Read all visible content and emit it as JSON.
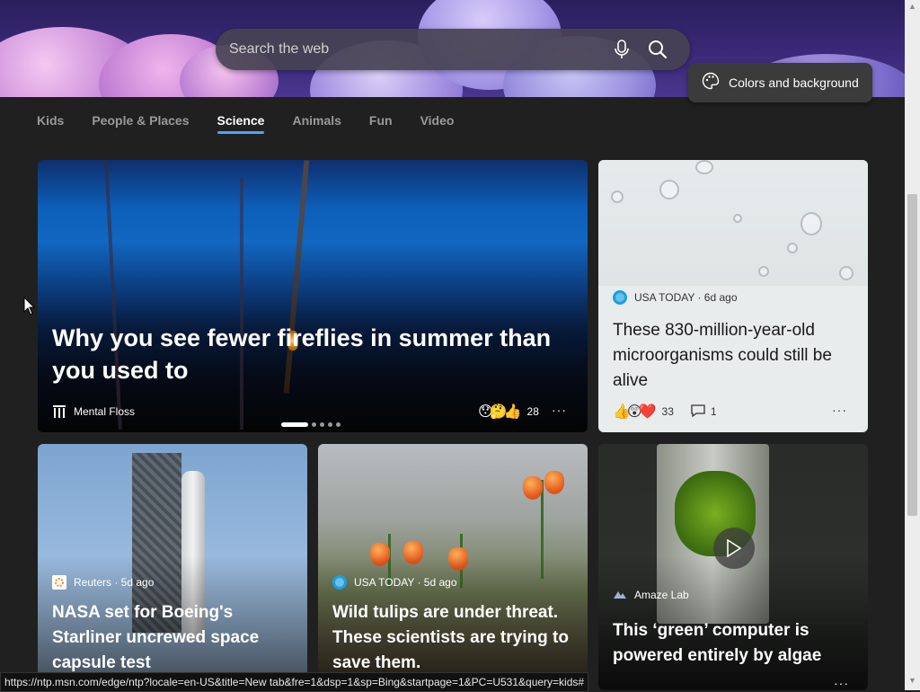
{
  "search": {
    "placeholder": "Search the web"
  },
  "colors_button": {
    "label": "Colors and background"
  },
  "tabs": [
    "Kids",
    "People & Places",
    "Science",
    "Animals",
    "Fun",
    "Video"
  ],
  "active_tab": "Science",
  "hero": {
    "title": "Why you see fewer fireflies in summer than you used to",
    "source": "Mental Floss",
    "reaction_count": "28",
    "more": "···",
    "carousel_pages": 5,
    "carousel_active": 1
  },
  "card_micro": {
    "source": "USA TODAY · 6d ago",
    "title": "These 830-million-year-old microorganisms could still be alive",
    "reaction_count": "33",
    "comment_count": "1",
    "more": "···"
  },
  "card_nasa": {
    "source": "Reuters · 5d ago",
    "title": "NASA set for Boeing's Starliner uncrewed space capsule test"
  },
  "card_tulips": {
    "source": "USA TODAY · 5d ago",
    "title": "Wild tulips are under threat. These scientists are trying to save them."
  },
  "card_algae": {
    "source": "Amaze Lab",
    "title": "This ‘green’ computer is powered entirely by algae",
    "more": "···"
  },
  "status_url": "https://ntp.msn.com/edge/ntp?locale=en-US&title=New tab&fre=1&dsp=1&sp=Bing&startpage=1&PC=U531&query=kids#",
  "colors": {
    "accent": "#4aa3ff",
    "background": "#202020"
  }
}
